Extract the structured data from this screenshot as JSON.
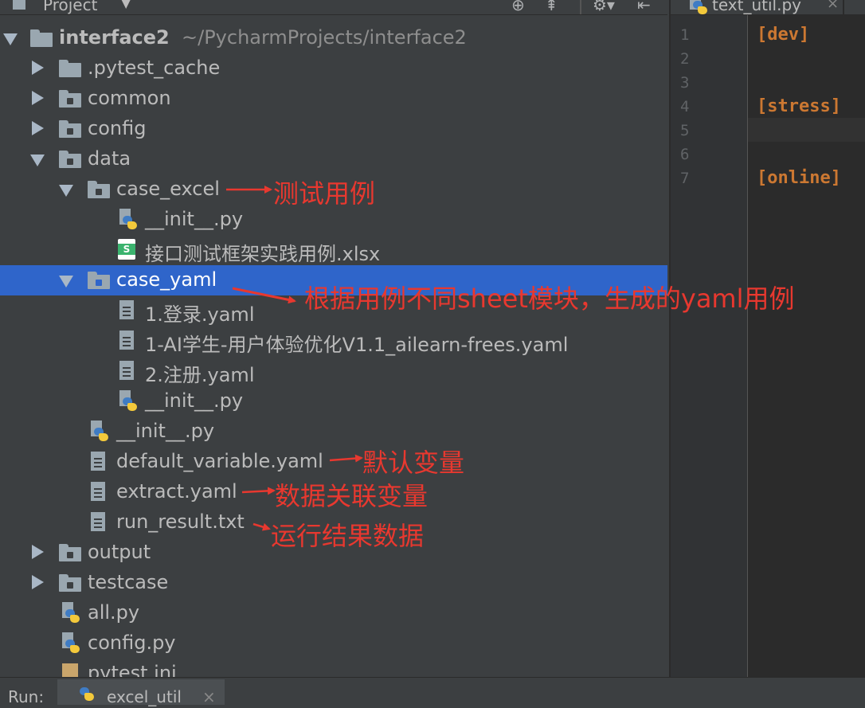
{
  "panel": {
    "title": "Project"
  },
  "tree": {
    "root": {
      "name": "interface2",
      "path": "~/PycharmProjects/interface2"
    },
    "items": [
      {
        "label": ".pytest_cache"
      },
      {
        "label": "common"
      },
      {
        "label": "config"
      },
      {
        "label": "data"
      },
      {
        "label": "case_excel"
      },
      {
        "label": "__init__.py"
      },
      {
        "label": "接口测试框架实践用例.xlsx"
      },
      {
        "label": "case_yaml"
      },
      {
        "label": "1.登录.yaml"
      },
      {
        "label": "1-AI学生-用户体验优化V1.1_ailearn-frees.yaml"
      },
      {
        "label": "2.注册.yaml"
      },
      {
        "label": "__init__.py"
      },
      {
        "label": "__init__.py"
      },
      {
        "label": "default_variable.yaml"
      },
      {
        "label": "extract.yaml"
      },
      {
        "label": "run_result.txt"
      },
      {
        "label": "output"
      },
      {
        "label": "testcase"
      },
      {
        "label": "all.py"
      },
      {
        "label": "config.py"
      },
      {
        "label": "pytest.ini"
      }
    ]
  },
  "annotations": {
    "case_excel": "测试用例",
    "case_yaml": "根据用例不同sheet模块，生成的yaml用例",
    "default_variable": "默认变量",
    "extract": "数据关联变量",
    "run_result": "运行结果数据"
  },
  "editor": {
    "tab_label": "text_util.py",
    "line_numbers": [
      "1",
      "2",
      "3",
      "4",
      "5",
      "6",
      "7"
    ],
    "lines": [
      "[dev]",
      "",
      "",
      "[stress]",
      "",
      "",
      "[online]"
    ]
  },
  "bottom": {
    "run_label": "Run:",
    "run_tab": "excel_util"
  },
  "colors": {
    "selection": "#2f65ca",
    "annotation": "#e8382f",
    "keyword": "#cc7832"
  }
}
